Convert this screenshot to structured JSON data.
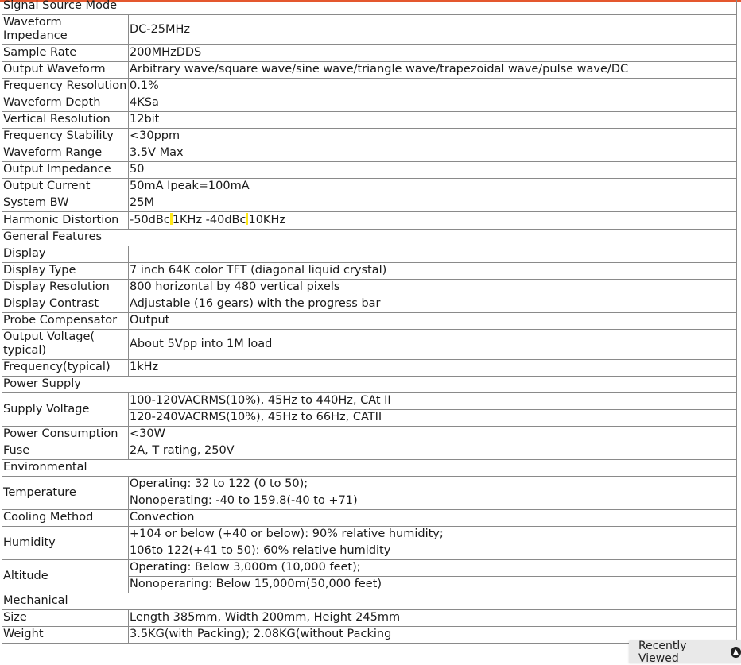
{
  "rows": [
    {
      "k": "Signal Source Mode",
      "v": null
    },
    {
      "k": "Waveform Impedance",
      "v": "DC-25MHz"
    },
    {
      "k": "Sample Rate",
      "v": "200MHzDDS"
    },
    {
      "k": "Output Waveform",
      "v": "Arbitrary wave/square wave/sine wave/triangle wave/trapezoidal wave/pulse wave/DC"
    },
    {
      "k": "Frequency Resolution",
      "v": "0.1%"
    },
    {
      "k": "Waveform Depth",
      "v": "4KSa"
    },
    {
      "k": "Vertical Resolution",
      "v": "12bit"
    },
    {
      "k": "Frequency Stability",
      "v": "<30ppm"
    },
    {
      "k": "Waveform Range",
      "v": "3.5V Max"
    },
    {
      "k": "Output Impedance",
      "v": "50"
    },
    {
      "k": "Output Current",
      "v": "50mA Ipeak=100mA"
    },
    {
      "k": "System BW",
      "v": "25M"
    },
    {
      "k": "Harmonic Distortion",
      "v_parts": [
        "-50dBc",
        "1KHz -40dBc",
        "10KHz"
      ]
    },
    {
      "k": "General Features",
      "v": null
    },
    {
      "k": "Display",
      "v": ""
    },
    {
      "k": "Display Type",
      "v": "7 inch 64K color TFT (diagonal liquid crystal)"
    },
    {
      "k": "Display Resolution",
      "v": "800 horizontal by 480 vertical pixels"
    },
    {
      "k": "Display Contrast",
      "v": "Adjustable (16 gears) with the progress bar"
    },
    {
      "k": "Probe Compensator",
      "v": "Output"
    },
    {
      "k": "Output Voltage( typical)",
      "v": "About 5Vpp into 1M load"
    },
    {
      "k": "Frequency(typical)",
      "v": "1kHz"
    },
    {
      "k": "Power Supply",
      "v": null
    },
    {
      "k": "Supply Voltage",
      "v_lines": [
        "100-120VACRMS(10%), 45Hz to 440Hz, CAt II",
        "120-240VACRMS(10%), 45Hz to 66Hz, CATII"
      ]
    },
    {
      "k": "Power Consumption",
      "v": "<30W"
    },
    {
      "k": "Fuse",
      "v": "2A, T rating, 250V"
    },
    {
      "k": "Environmental",
      "v": null
    },
    {
      "k": "Temperature",
      "v_lines": [
        "Operating: 32 to 122 (0 to 50);",
        "Nonoperating: -40 to 159.8(-40 to +71)"
      ]
    },
    {
      "k": "Cooling Method",
      "v": "Convection"
    },
    {
      "k": "Humidity",
      "v_lines": [
        "+104 or below (+40 or below): 90% relative humidity;",
        "106to 122(+41 to 50): 60% relative humidity"
      ]
    },
    {
      "k": "Altitude",
      "v_lines": [
        "Operating: Below 3,000m (10,000 feet);",
        "Nonoperaring: Below 15,000m(50,000 feet)"
      ]
    },
    {
      "k": "Mechanical",
      "v": null
    },
    {
      "k": "Size",
      "v": "Length 385mm, Width 200mm, Height 245mm"
    },
    {
      "k": "Weight",
      "v": "3.5KG(with Packing); 2.08KG(without Packing"
    }
  ],
  "recently_viewed": {
    "label": "Recently Viewed",
    "icon": "chevron-up-icon"
  },
  "colors": {
    "top_accent": "#e4572e",
    "highlight": "#ffe81a"
  }
}
